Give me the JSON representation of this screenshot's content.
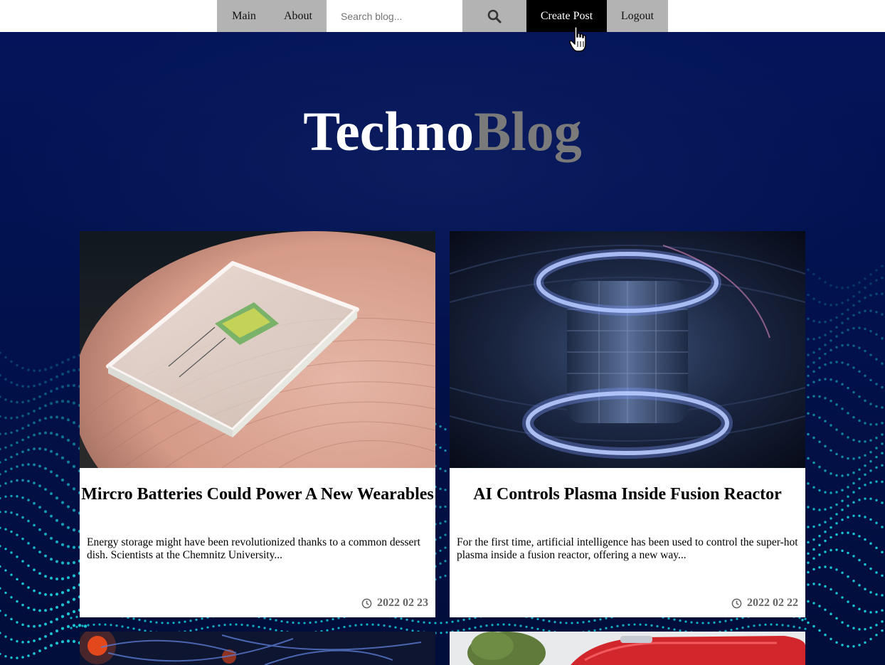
{
  "nav": {
    "main_label": "Main",
    "about_label": "About",
    "search_placeholder": "Search blog...",
    "search_icon": "search-icon",
    "create_label": "Create Post",
    "logout_label": "Logout"
  },
  "hero": {
    "title_part1": "Techno",
    "title_part2": "Blog"
  },
  "posts": [
    {
      "title": "Mircro Batteries Could Power A New Wearables",
      "excerpt": "Energy storage might have been revolutionized thanks to a common dessert dish. Scientists at the Chemnitz University...",
      "date": "2022 02 23",
      "image": "micro-battery-on-fingertip"
    },
    {
      "title": "AI Controls Plasma Inside Fusion Reactor",
      "excerpt": "For the first time, artificial intelligence has been used to control the super-hot plasma inside a fusion reactor, offering a new way...",
      "date": "2022 02 22",
      "image": "fusion-reactor-interior"
    },
    {
      "image": "neural-network-lights"
    },
    {
      "image": "red-car-with-tree"
    }
  ],
  "colors": {
    "background": "#03123f",
    "accent_dots": "#18c6d6",
    "nav_gray": "#b3b3b3",
    "create_bg": "#000000",
    "title_gray": "#7a7a7a"
  }
}
